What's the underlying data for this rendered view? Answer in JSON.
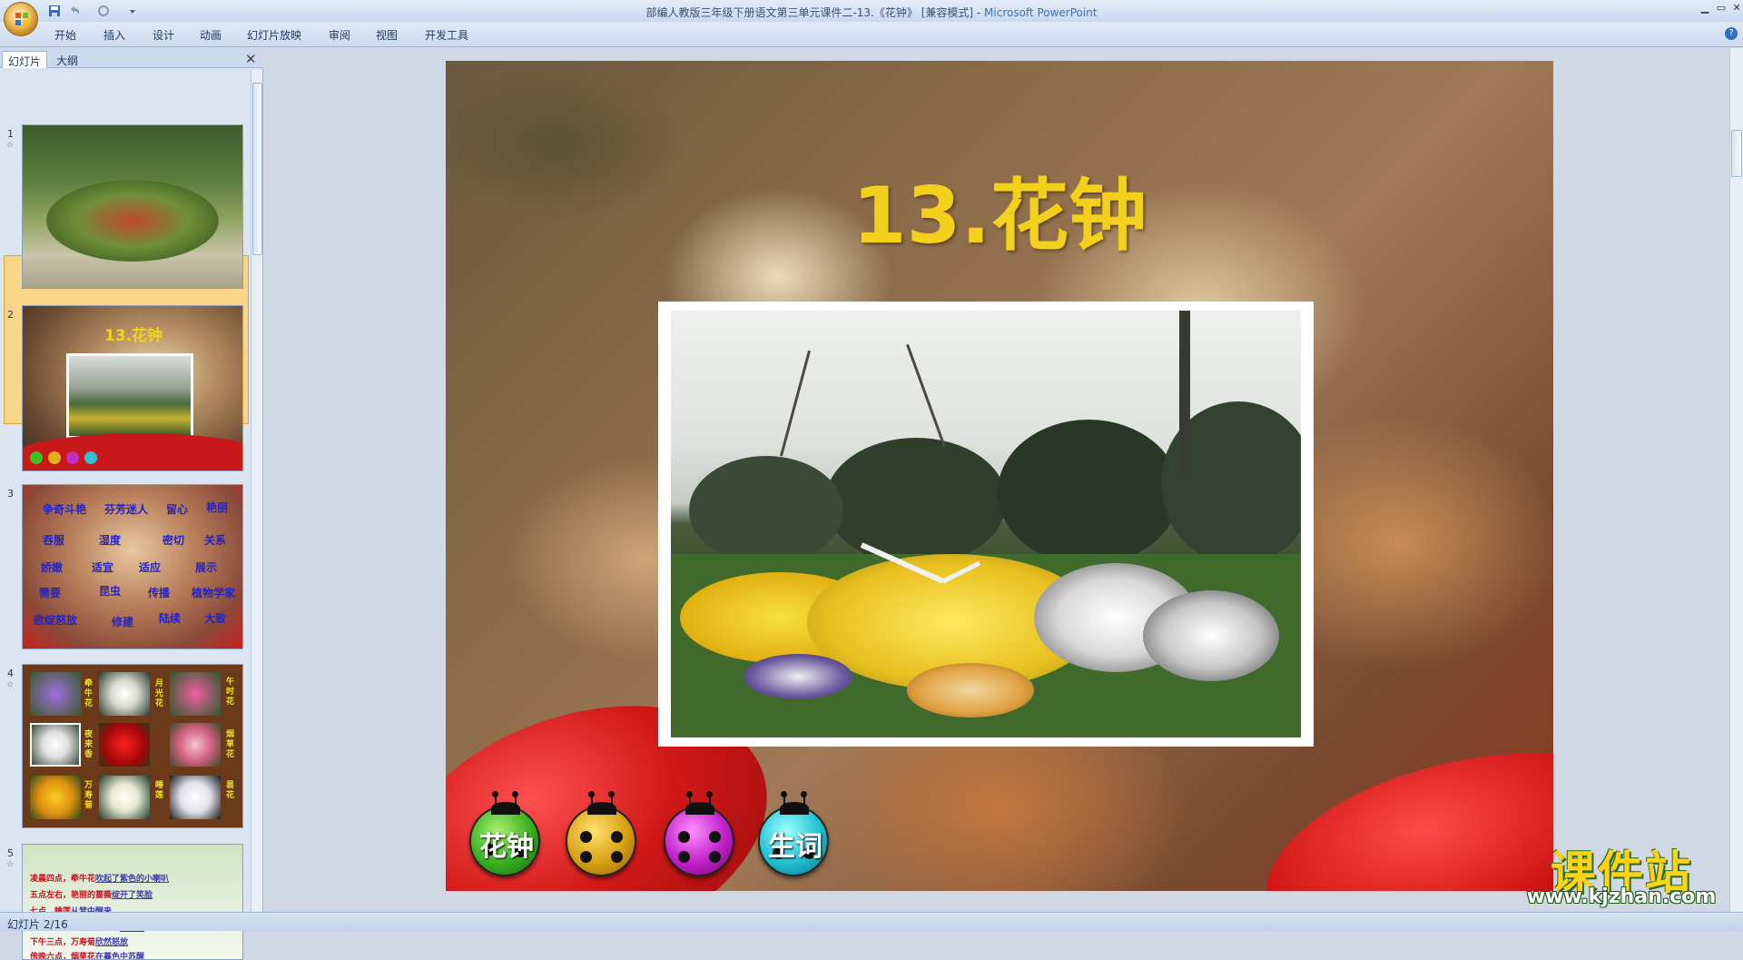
{
  "window": {
    "title": "部编人教版三年级下册语文第三单元课件二-13.《花钟》 [兼容模式] - ",
    "app_name": "Microsoft PowerPoint",
    "min": "▁",
    "max": "▭",
    "close": "✕"
  },
  "ribbon": {
    "tabs": [
      "开始",
      "插入",
      "设计",
      "动画",
      "幻灯片放映",
      "审阅",
      "视图",
      "开发工具"
    ],
    "help": "?"
  },
  "left_pane": {
    "tabs": [
      "幻灯片",
      "大纲"
    ],
    "close": "✕",
    "slides": [
      {
        "num": "1",
        "star": "☆"
      },
      {
        "num": "2",
        "star": "",
        "title": "13.花钟",
        "selected": true
      },
      {
        "num": "3",
        "star": "",
        "words": [
          "争奇斗艳",
          "芬芳迷人",
          "留心",
          "艳丽",
          "吞服",
          "湿度",
          "密切",
          "关系",
          "娇嫩",
          "适宜",
          "适应",
          "展示",
          "需要",
          "昆虫",
          "传播",
          "植物学家",
          "欲绽怒放",
          "修建",
          "陆续",
          "大致"
        ]
      },
      {
        "num": "4",
        "star": "☆",
        "labels": [
          "牵牛花",
          "月光花",
          "午时花",
          "夜来香",
          "烟草花",
          "万寿菊",
          "睡莲",
          "昙花"
        ]
      },
      {
        "num": "5",
        "star": "☆",
        "lines": [
          {
            "text": "凌晨四点，牵牛花",
            "link": "吹起了紫色的小喇叭"
          },
          {
            "text": "五点左右，艳丽的蔷薇",
            "link": "绽开了笑脸"
          },
          {
            "text": "七点，睡莲",
            "link": "从梦中醒来"
          },
          {
            "text": "中午十二点左右，午时花",
            "link": "开花了"
          },
          {
            "text": "下午三点，万寿菊",
            "link": "欣然怒放"
          },
          {
            "text": "傍晚六点，烟草花",
            "link": "在暮色中苏醒"
          }
        ]
      }
    ]
  },
  "slide": {
    "title": "13.花钟",
    "buttons": [
      "花钟",
      "",
      "",
      "生词"
    ]
  },
  "watermark": {
    "main": "课件站",
    "url": "www.kjzhan.com"
  },
  "status": {
    "text": "幻灯片 2/16"
  },
  "colors": {
    "title_yellow": "#f3d01c",
    "ribbon_red": "#d01818",
    "chrome_blue": "#cfd8e4"
  }
}
